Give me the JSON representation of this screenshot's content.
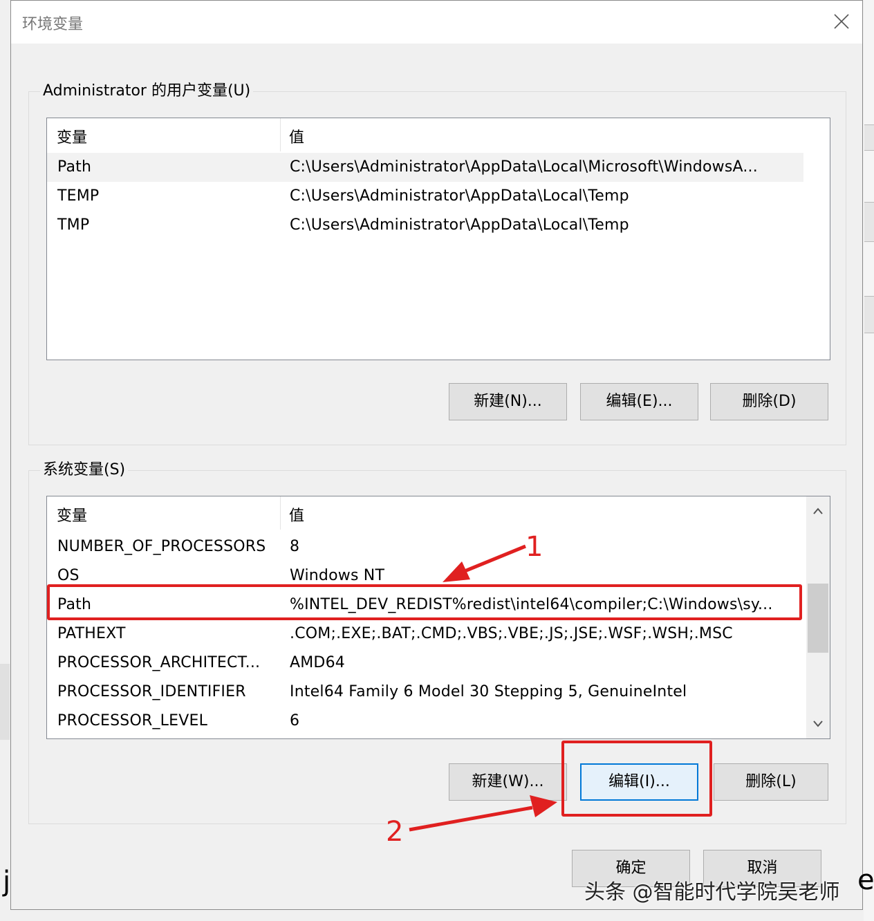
{
  "dialog": {
    "title": "环境变量",
    "close_icon": "close-icon"
  },
  "user_vars": {
    "label": "Administrator 的用户变量(U)",
    "headers": {
      "name": "变量",
      "value": "值"
    },
    "rows": [
      {
        "name": "Path",
        "value": "C:\\Users\\Administrator\\AppData\\Local\\Microsoft\\WindowsA..."
      },
      {
        "name": "TEMP",
        "value": "C:\\Users\\Administrator\\AppData\\Local\\Temp"
      },
      {
        "name": "TMP",
        "value": "C:\\Users\\Administrator\\AppData\\Local\\Temp"
      }
    ],
    "buttons": {
      "new": "新建(N)...",
      "edit": "编辑(E)...",
      "delete": "删除(D)"
    }
  },
  "system_vars": {
    "label": "系统变量(S)",
    "headers": {
      "name": "变量",
      "value": "值"
    },
    "rows": [
      {
        "name": "NUMBER_OF_PROCESSORS",
        "value": "8"
      },
      {
        "name": "OS",
        "value": "Windows NT"
      },
      {
        "name": "Path",
        "value": "%INTEL_DEV_REDIST%redist\\intel64\\compiler;C:\\Windows\\sy..."
      },
      {
        "name": "PATHEXT",
        "value": ".COM;.EXE;.BAT;.CMD;.VBS;.VBE;.JS;.JSE;.WSF;.WSH;.MSC"
      },
      {
        "name": "PROCESSOR_ARCHITECT...",
        "value": "AMD64"
      },
      {
        "name": "PROCESSOR_IDENTIFIER",
        "value": "Intel64 Family 6 Model 30 Stepping 5, GenuineIntel"
      },
      {
        "name": "PROCESSOR_LEVEL",
        "value": "6"
      }
    ],
    "buttons": {
      "new": "新建(W)...",
      "edit": "编辑(I)...",
      "delete": "删除(L)"
    }
  },
  "footer": {
    "ok": "确定",
    "cancel": "取消"
  },
  "annotations": {
    "step1": "1",
    "step2": "2",
    "color": "#e02020"
  },
  "watermark": "头条 @智能时代学院吴老师",
  "edge_chars": {
    "left": "j",
    "right": "e"
  }
}
